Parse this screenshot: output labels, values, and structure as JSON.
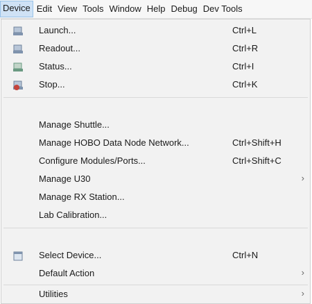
{
  "menubar": {
    "items": [
      "Device",
      "Edit",
      "View",
      "Tools",
      "Window",
      "Help",
      "Debug",
      "Dev Tools"
    ]
  },
  "menu": {
    "items": [
      {
        "label": "Launch...",
        "shortcut": "Ctrl+L",
        "icon": "launch-icon"
      },
      {
        "label": "Readout...",
        "shortcut": "Ctrl+R",
        "icon": "readout-icon"
      },
      {
        "label": "Status...",
        "shortcut": "Ctrl+I",
        "icon": "status-icon"
      },
      {
        "label": "Stop...",
        "shortcut": "Ctrl+K",
        "icon": "stop-icon"
      },
      {
        "label": "Manage Shuttle..."
      },
      {
        "label": "Manage HOBO Data Node Network...",
        "shortcut": "Ctrl+Shift+H"
      },
      {
        "label": "Configure Modules/Ports...",
        "shortcut": "Ctrl+Shift+C"
      },
      {
        "label": "Manage U30",
        "submenu": "›"
      },
      {
        "label": "Manage RX Station..."
      },
      {
        "label": "Lab Calibration..."
      },
      {
        "label": "Select Device...",
        "shortcut": "Ctrl+N",
        "icon": "device-icon"
      },
      {
        "label": "Default Action",
        "submenu": "›"
      },
      {
        "label": "Utilities",
        "submenu": "›"
      }
    ]
  },
  "colors": {
    "menubar_active_bg": "#cfe2f5",
    "menu_bg": "#f2f2f2",
    "launch_icon": "#7f93ad",
    "status_icon": "#6a9a82",
    "stop_icon": "#c4443c"
  }
}
